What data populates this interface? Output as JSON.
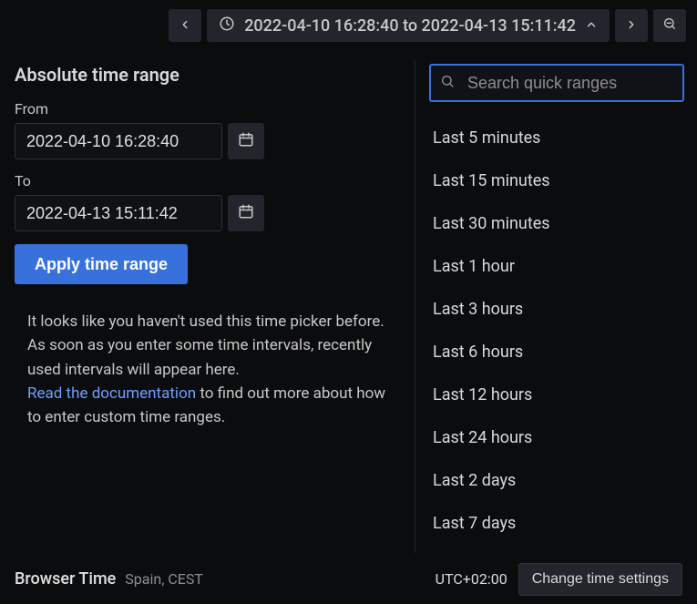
{
  "toolbar": {
    "range_text": "2022-04-10 16:28:40 to 2022-04-13 15:11:42"
  },
  "absolute": {
    "heading": "Absolute time range",
    "from_label": "From",
    "from_value": "2022-04-10 16:28:40",
    "to_label": "To",
    "to_value": "2022-04-13 15:11:42",
    "apply_label": "Apply time range"
  },
  "hint": {
    "text1": "It looks like you haven't used this time picker before. As soon as you enter some time intervals, recently used intervals will appear here.",
    "link_text": "Read the documentation",
    "text2": " to find out more about how to enter custom time ranges."
  },
  "search": {
    "placeholder": "Search quick ranges"
  },
  "quick_ranges": [
    "Last 5 minutes",
    "Last 15 minutes",
    "Last 30 minutes",
    "Last 1 hour",
    "Last 3 hours",
    "Last 6 hours",
    "Last 12 hours",
    "Last 24 hours",
    "Last 2 days",
    "Last 7 days"
  ],
  "footer": {
    "browser_time_label": "Browser Time",
    "browser_time_value": "Spain, CEST",
    "utc_offset": "UTC+02:00",
    "change_label": "Change time settings"
  }
}
